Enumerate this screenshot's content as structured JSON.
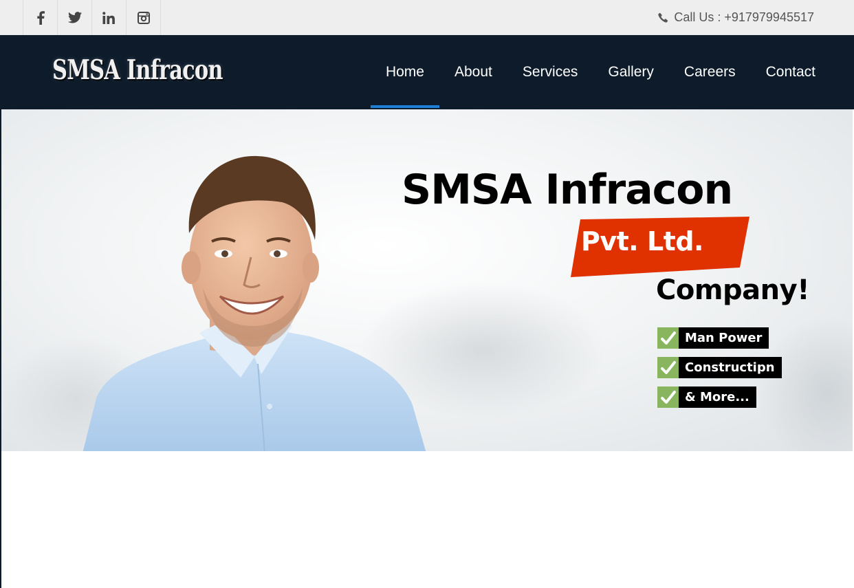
{
  "topbar": {
    "social": [
      {
        "icon": "facebook-icon"
      },
      {
        "icon": "twitter-icon"
      },
      {
        "icon": "linkedin-icon"
      },
      {
        "icon": "instagram-icon"
      }
    ],
    "call_text": "Call Us : +917979945517",
    "call_icon": "phone-icon"
  },
  "nav": {
    "logo": "SMSA Infracon",
    "items": [
      {
        "label": "Home"
      },
      {
        "label": "About"
      },
      {
        "label": "Services"
      },
      {
        "label": "Gallery"
      },
      {
        "label": "Careers"
      },
      {
        "label": "Contact"
      }
    ],
    "active": "Home"
  },
  "hero": {
    "title": "SMSA Infracon",
    "badge": "Pvt. Ltd.",
    "subtitle": "Company!",
    "features": [
      {
        "label": "Man Power"
      },
      {
        "label": "Constructipn"
      },
      {
        "label": "& More..."
      }
    ]
  },
  "colors": {
    "nav_bg": "#0d1b2b",
    "active_underline": "#1e7fd6",
    "badge_red": "#e03200",
    "check_green": "#8ab55f"
  }
}
